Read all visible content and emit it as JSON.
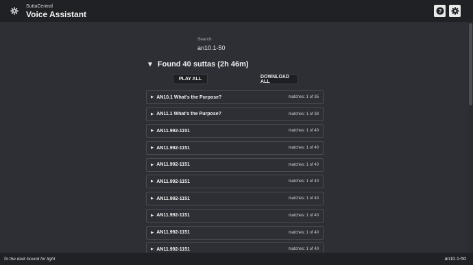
{
  "app": {
    "subtitle": "SuttaCentral",
    "title": "Voice Assistant"
  },
  "icons": {
    "logo": "wheel-icon",
    "help": "help-icon",
    "settings": "gear-icon"
  },
  "search": {
    "label": "Search",
    "value": "an10.1-50"
  },
  "results": {
    "heading": "Found 40 suttas (2h 46m)",
    "play_all": "PLAY ALL",
    "download_all": "DOWNLOAD ALL",
    "items": [
      {
        "title": "AN10.1 What’s the Purpose?",
        "matches": "matches: 1 of 35"
      },
      {
        "title": "AN11.1 What’s the Purpose?",
        "matches": "matches: 1 of 38"
      },
      {
        "title": "AN11.992-1151",
        "matches": "matches: 1 of 40"
      },
      {
        "title": "AN11.992-1151",
        "matches": "matches: 1 of 40"
      },
      {
        "title": "AN11.992-1151",
        "matches": "matches: 1 of 40"
      },
      {
        "title": "AN11.992-1151",
        "matches": "matches: 1 of 40"
      },
      {
        "title": "AN11.992-1151",
        "matches": "matches: 1 of 40"
      },
      {
        "title": "AN11.992-1151",
        "matches": "matches: 1 of 40"
      },
      {
        "title": "AN11.992-1151",
        "matches": "matches: 1 of 40"
      },
      {
        "title": "AN11.992-1151",
        "matches": "matches: 1 of 40"
      }
    ]
  },
  "footer": {
    "left": "To the dark bound for light",
    "right": "an10.1-50"
  },
  "colors": {
    "background": "#2d2f35",
    "bar": "#202124",
    "row_border": "#4a4c53"
  }
}
